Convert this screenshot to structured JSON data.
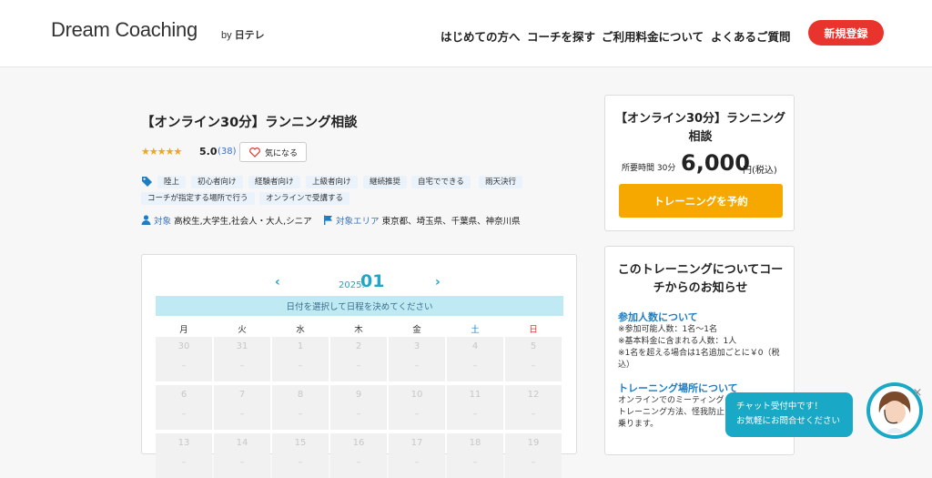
{
  "header": {
    "logo": "Dream Coaching",
    "logo_by": "by",
    "logo_partner": "日テレ",
    "nav": [
      "はじめての方へ",
      "コーチを探す",
      "ご利用料金について",
      "よくあるご質問"
    ],
    "signup": "新規登録"
  },
  "training": {
    "title": "【オンライン30分】ランニング相談",
    "stars": "★★★★★",
    "rating": "5.0",
    "review_count": "(38)",
    "favorite_label": "気になる",
    "tags": [
      "陸上",
      "初心者向け",
      "経験者向け",
      "上級者向け",
      "継続推奨",
      "自宅でできる",
      "雨天決行",
      "コーチが指定する場所で行う",
      "オンラインで受講する"
    ],
    "target_label": "対象",
    "target_value": "高校生,大学生,社会人・大人,シニア",
    "area_label": "対象エリア",
    "area_value": "東京都、埼玉県、千葉県、神奈川県"
  },
  "calendar": {
    "prev": "‹",
    "next": "›",
    "year": "2025.",
    "month": "01",
    "hint": "日付を選択して日程を決めてください",
    "weekdays": [
      "月",
      "火",
      "水",
      "木",
      "金",
      "土",
      "日"
    ],
    "weekday_colors": [
      "#333333",
      "#333333",
      "#333333",
      "#333333",
      "#333333",
      "#1c7ec4",
      "#e8342c"
    ],
    "weeks": [
      [
        "30",
        "31",
        "1",
        "2",
        "3",
        "4",
        "5"
      ],
      [
        "6",
        "7",
        "8",
        "9",
        "10",
        "11",
        "12"
      ],
      [
        "13",
        "14",
        "15",
        "16",
        "17",
        "18",
        "19"
      ]
    ],
    "empty_mark": "–"
  },
  "pricebox": {
    "title": "【オンライン30分】ランニング相談",
    "duration": "所要時間 30分",
    "price": "6,000",
    "tax": "円(税込)",
    "reserve": "トレーニングを予約"
  },
  "notice": {
    "title": "このトレーニングについてコーチからのお知らせ",
    "section1": "参加人数について",
    "lines1": [
      "※参加可能人数：1名〜1名",
      "※基本料金に含まれる人数：1人",
      "※1名を超える場合は1名追加ごとに￥0（税込）"
    ],
    "section2": "トレーニング場所について",
    "lines2": [
      "オンラインでのミーティング",
      "トレーニング方法、怪我防止",
      "乗ります。"
    ]
  },
  "chat": {
    "line1": "チャット受付中です！",
    "line2": "お気軽にお問合せください",
    "close": "×"
  },
  "colors": {
    "accent": "#1aa8c7",
    "signup": "#e8342c",
    "reserve": "#f6a800",
    "link": "#1c7ec4"
  }
}
